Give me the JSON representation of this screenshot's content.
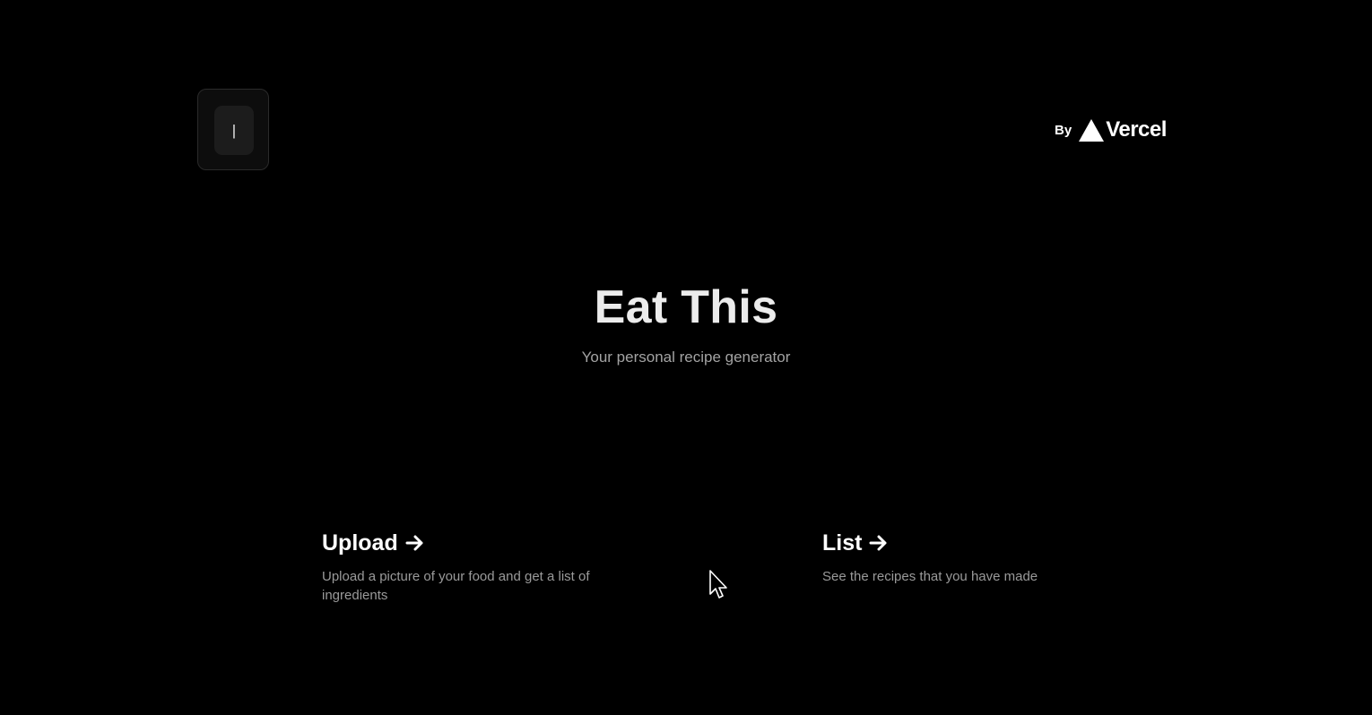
{
  "header": {
    "logo_glyph": "|",
    "by_label": "By",
    "brand_name": "Vercel"
  },
  "hero": {
    "title": "Eat This",
    "subtitle": "Your personal recipe generator"
  },
  "cards": [
    {
      "title": "Upload",
      "arrow_icon": "arrow-right-icon",
      "description": "Upload a picture of your food and get a list of ingredients"
    },
    {
      "title": "List",
      "arrow_icon": "arrow-right-icon",
      "description": "See the recipes that you have made"
    }
  ],
  "colors": {
    "background": "#000000",
    "title": "#ececec",
    "muted_text": "#9a9a9a"
  }
}
